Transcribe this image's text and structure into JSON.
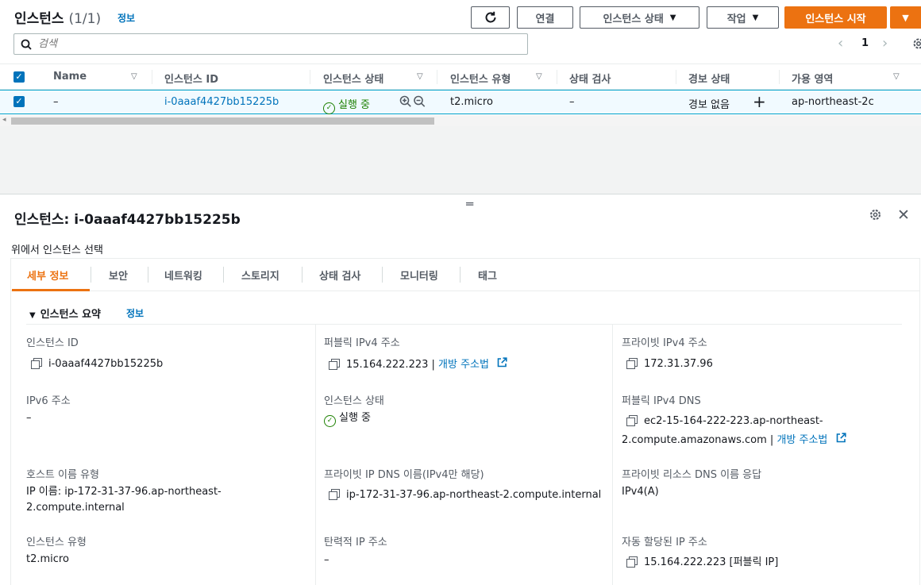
{
  "header": {
    "title": "인스턴스",
    "count": "(1/1)",
    "info": "정보",
    "buttons": {
      "refresh_icon": "refresh-icon",
      "connect": "연결",
      "instance_state": "인스턴스 상태",
      "actions": "작업",
      "launch": "인스턴스 시작"
    }
  },
  "search": {
    "placeholder": "검색"
  },
  "pagination": {
    "page": "1"
  },
  "table": {
    "columns": [
      "Name",
      "인스턴스 ID",
      "인스턴스 상태",
      "인스턴스 유형",
      "상태 검사",
      "경보 상태",
      "가용 영역"
    ],
    "rows": [
      {
        "name": "–",
        "instance_id": "i-0aaaf4427bb15225b",
        "state": "실행 중",
        "type": "t2.micro",
        "status_check": "–",
        "alarm": "경보 없음",
        "az": "ap-northeast-2c"
      }
    ]
  },
  "details": {
    "title_prefix": "인스턴스:",
    "instance_id": "i-0aaaf4427bb15225b",
    "select_note": "위에서 인스턴스 선택",
    "tabs": [
      "세부 정보",
      "보안",
      "네트워킹",
      "스토리지",
      "상태 검사",
      "모니터링",
      "태그"
    ],
    "summary_title": "인스턴스 요약",
    "summary_info": "정보",
    "fields": {
      "instance_id_label": "인스턴스 ID",
      "instance_id_value": "i-0aaaf4427bb15225b",
      "public_ipv4_label": "퍼블릭 IPv4 주소",
      "public_ipv4_value": "15.164.222.223",
      "open_address": "개방 주소법",
      "private_ipv4_label": "프라이빗 IPv4 주소",
      "private_ipv4_value": "172.31.37.96",
      "ipv6_label": "IPv6 주소",
      "ipv6_value": "–",
      "state_label": "인스턴스 상태",
      "state_value": "실행 중",
      "public_dns_label": "퍼블릭 IPv4 DNS",
      "public_dns_line1": "ec2-15-164-222-223.ap-northeast-",
      "public_dns_line2": "2.compute.amazonaws.com",
      "hostname_type_label": "호스트 이름 유형",
      "hostname_type_line1": "IP 이름: ip-172-31-37-96.ap-northeast-",
      "hostname_type_line2": "2.compute.internal",
      "private_dns_label": "프라이빗 IP DNS 이름(IPv4만 해당)",
      "private_dns_value": "ip-172-31-37-96.ap-northeast-2.compute.internal",
      "private_resource_dns_label": "프라이빗 리소스 DNS 이름 응답",
      "private_resource_dns_value": "IPv4(A)",
      "instance_type_label": "인스턴스 유형",
      "instance_type_value": "t2.micro",
      "elastic_ip_label": "탄력적 IP 주소",
      "elastic_ip_value": "–",
      "auto_ip_label": "자동 할당된 IP 주소",
      "auto_ip_value": "15.164.222.223 [퍼블릭 IP]"
    }
  },
  "colors": {
    "primary": "#ec7211",
    "link": "#0073bb",
    "success": "#1d8102",
    "selected_row": "#f1faff"
  }
}
